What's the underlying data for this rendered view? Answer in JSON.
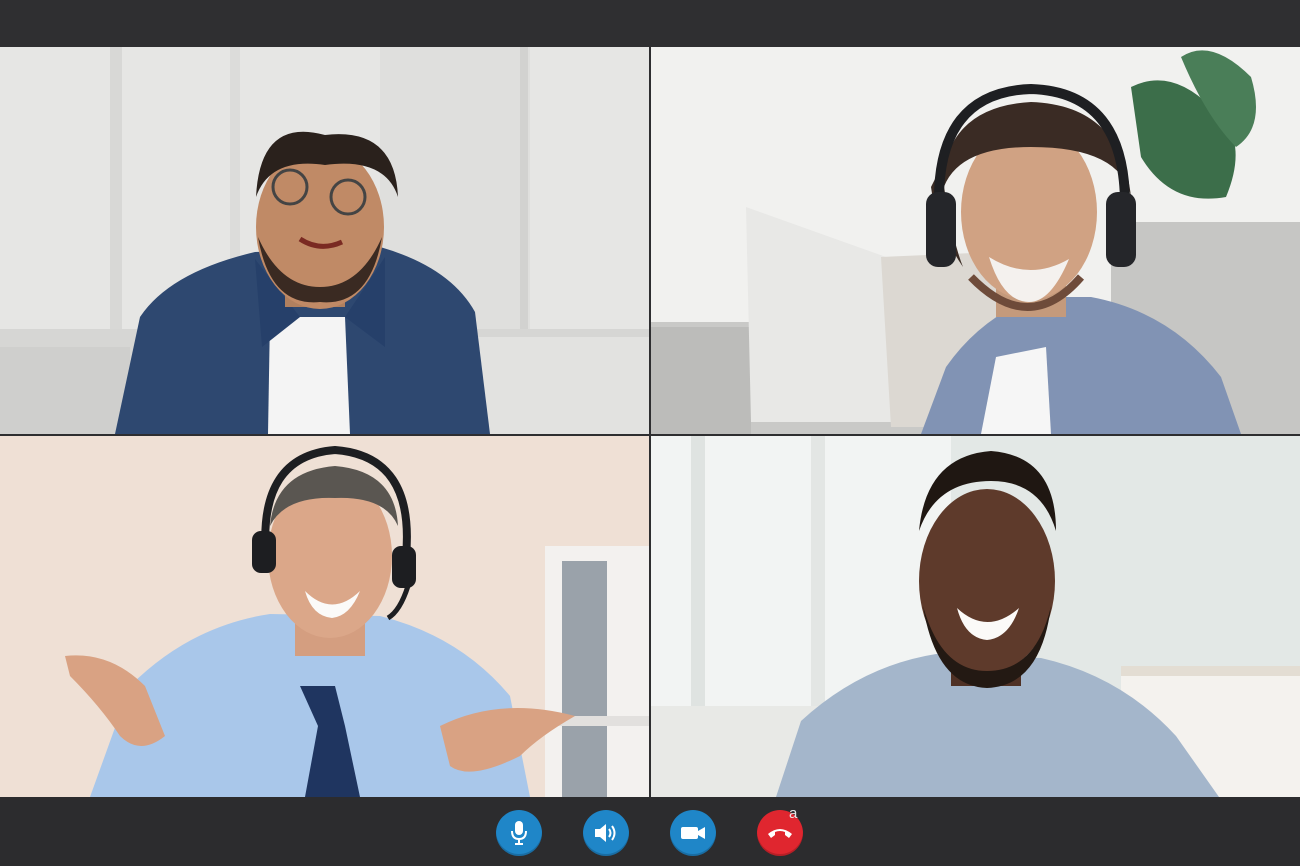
{
  "participants": [
    {
      "id": "tile-1",
      "scene": "man-glasses-denim-shirt-living-room"
    },
    {
      "id": "tile-2",
      "scene": "man-headphones-sofa"
    },
    {
      "id": "tile-3",
      "scene": "man-headset-tie-office"
    },
    {
      "id": "tile-4",
      "scene": "man-smiling-light-shirt-window"
    }
  ],
  "controls": {
    "mic": {
      "icon": "microphone-icon",
      "color": "#1f86c8"
    },
    "speaker": {
      "icon": "speaker-icon",
      "color": "#1f86c8"
    },
    "video": {
      "icon": "video-camera-icon",
      "color": "#1f86c8"
    },
    "hangup": {
      "icon": "phone-hangup-icon",
      "color": "#e0262f",
      "badge": "a"
    }
  },
  "colors": {
    "background": "#2e2e30",
    "accent": "#1f86c8",
    "danger": "#e0262f"
  }
}
